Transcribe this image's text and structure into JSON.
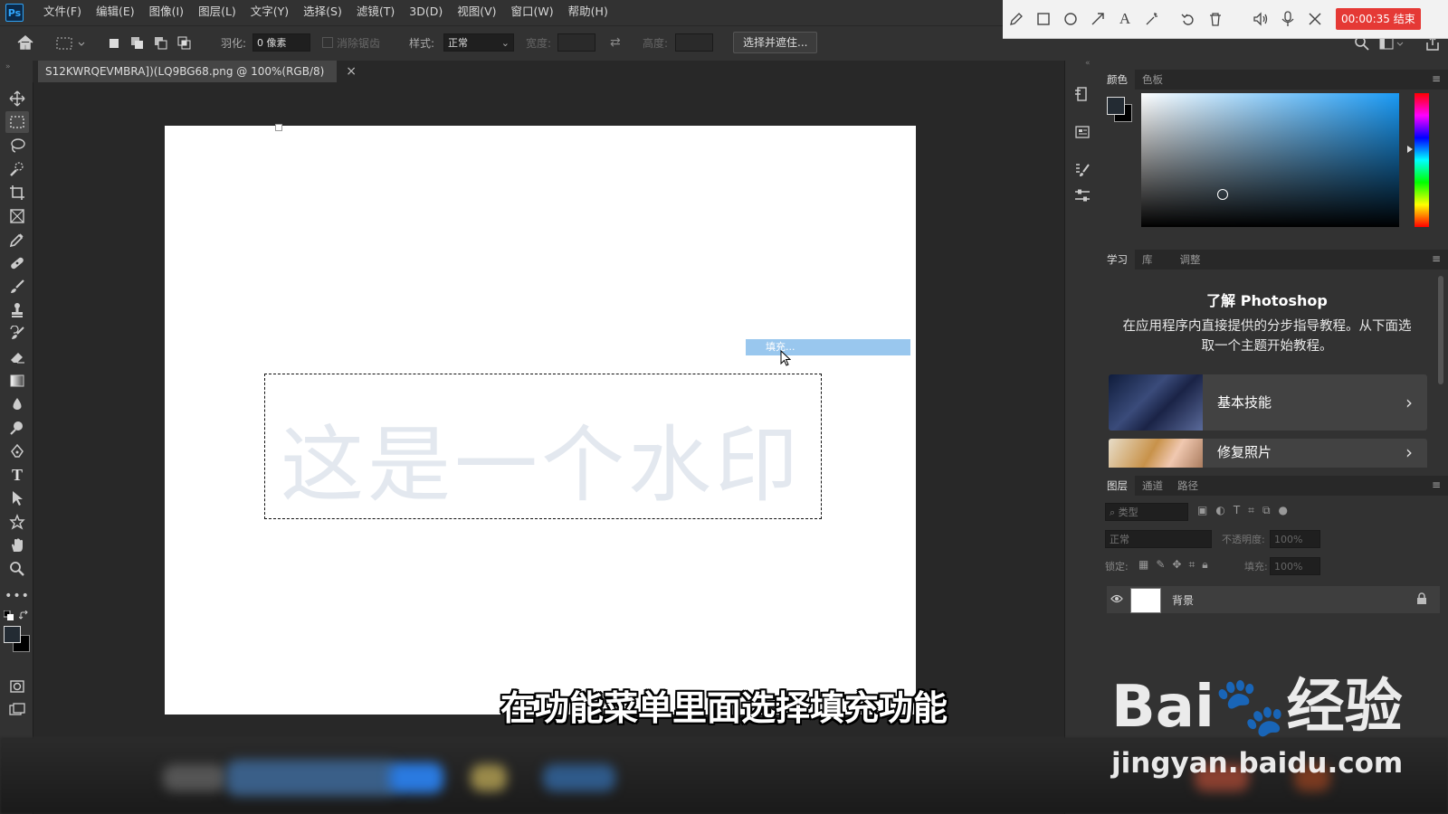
{
  "app": {
    "logo": "Ps"
  },
  "menu": [
    "文件(F)",
    "编辑(E)",
    "图像(I)",
    "图层(L)",
    "文字(Y)",
    "选择(S)",
    "滤镜(T)",
    "3D(D)",
    "视图(V)",
    "窗口(W)",
    "帮助(H)"
  ],
  "recorder": {
    "timer": "00:00:35 结束",
    "icons": [
      "pencil-icon",
      "rectangle-icon",
      "circle-icon",
      "arrow-icon",
      "text-icon",
      "magic-wand-icon",
      "undo-icon",
      "trash-icon",
      "speaker-icon",
      "microphone-icon",
      "close-icon"
    ]
  },
  "options": {
    "feather_label": "羽化:",
    "feather_value": "0 像素",
    "antialias_label": "消除锯齿",
    "style_label": "样式:",
    "style_value": "正常",
    "width_label": "宽度:",
    "height_label": "高度:",
    "select_mask_button": "选择并遮住..."
  },
  "document": {
    "tab_title": "S12KWRQEVMBRA])(LQ9BG68.png @ 100%(RGB/8)",
    "tab_close": "×",
    "watermark_text": "这是一个水印",
    "context_menu_item": "填充..."
  },
  "color_panel": {
    "tabs": [
      "颜色",
      "色板"
    ],
    "foreground": "#232b33",
    "background": "#000000"
  },
  "learn_panel": {
    "tabs": [
      "学习",
      "库",
      "调整"
    ],
    "title": "了解 Photoshop",
    "description": "在应用程序内直接提供的分步指导教程。从下面选取一个主题开始教程。",
    "cards": [
      {
        "label": "基本技能"
      },
      {
        "label": "修复照片"
      }
    ]
  },
  "layers_panel": {
    "tabs": [
      "图层",
      "通道",
      "路径"
    ],
    "filter_placeholder": "类型",
    "blend_mode": "正常",
    "opacity_label": "不透明度:",
    "opacity_value": "100%",
    "lock_label": "锁定:",
    "fill_label": "填充:",
    "fill_value": "100%",
    "layers": [
      {
        "name": "背景",
        "visible": true,
        "locked": true
      }
    ]
  },
  "overlay": {
    "caption": "在功能菜单里面选择填充功能",
    "brand": "Bai🐾经验",
    "brand_url": "jingyan.baidu.com"
  },
  "colors": {
    "accent_selection": "#99c7ee",
    "timer_red": "#e53935"
  }
}
